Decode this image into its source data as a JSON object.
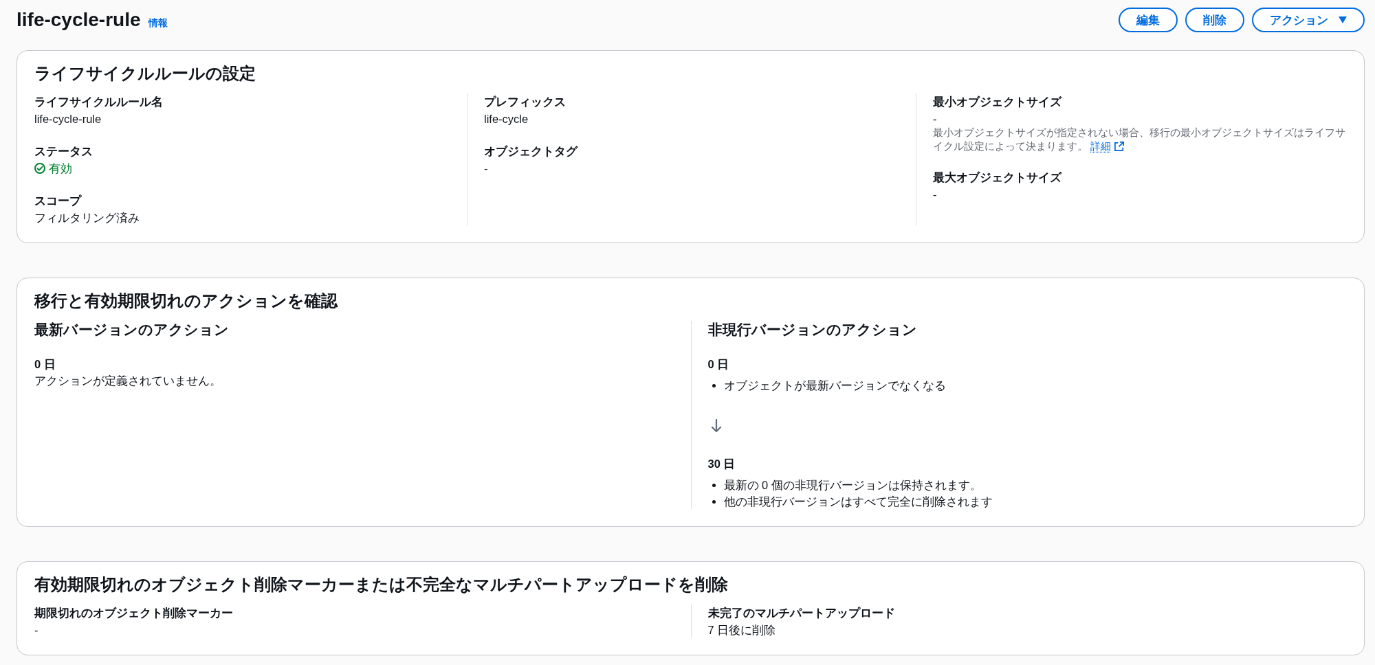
{
  "header": {
    "title": "life-cycle-rule",
    "info_link": "情報",
    "buttons": [
      {
        "label": "編集",
        "kind": "plain"
      },
      {
        "label": "削除",
        "kind": "plain"
      },
      {
        "label": "アクション",
        "kind": "dropdown"
      }
    ]
  },
  "rule_settings": {
    "title": "ライフサイクルルールの設定",
    "columns": [
      {
        "fields": [
          {
            "label": "ライフサイクルルール名",
            "value": "life-cycle-rule"
          },
          {
            "label": "ステータス",
            "value": "有効",
            "success": true
          },
          {
            "label": "スコープ",
            "value": "フィルタリング済み"
          }
        ]
      },
      {
        "fields": [
          {
            "label": "プレフィックス",
            "value": "life-cycle"
          },
          {
            "label": "オブジェクトタグ",
            "value": "-"
          }
        ]
      },
      {
        "fields": [
          {
            "label": "最小オブジェクトサイズ",
            "value": "-",
            "description": "最小オブジェクトサイズが指定されない場合、移行の最小オブジェクトサイズはライフサイクル設定によって決まります。",
            "link": "詳細"
          },
          {
            "label": "最大オブジェクトサイズ",
            "value": "-"
          }
        ]
      }
    ]
  },
  "action_review": {
    "title": "移行と有効期限切れのアクションを確認",
    "columns": [
      {
        "title": "最新バージョンのアクション",
        "steps": [
          {
            "kind": "text",
            "day": "0 日",
            "text": "アクションが定義されていません。"
          }
        ]
      },
      {
        "title": "非現行バージョンのアクション",
        "steps": [
          {
            "kind": "list",
            "day": "0 日",
            "items": [
              "オブジェクトが最新バージョンでなくなる"
            ]
          },
          {
            "kind": "list",
            "day": "30 日",
            "items": [
              "最新の 0 個の非現行バージョンは保持されます。",
              "他の非現行バージョンはすべて完全に削除されます"
            ]
          }
        ]
      }
    ]
  },
  "cleanup": {
    "title": "有効期限切れのオブジェクト削除マーカーまたは不完全なマルチパートアップロードを削除",
    "columns": [
      {
        "fields": [
          {
            "label": "期限切れのオブジェクト削除マーカー",
            "value": "-"
          }
        ]
      },
      {
        "fields": [
          {
            "label": "未完了のマルチパートアップロード",
            "value": "7 日後に削除"
          }
        ]
      }
    ]
  }
}
